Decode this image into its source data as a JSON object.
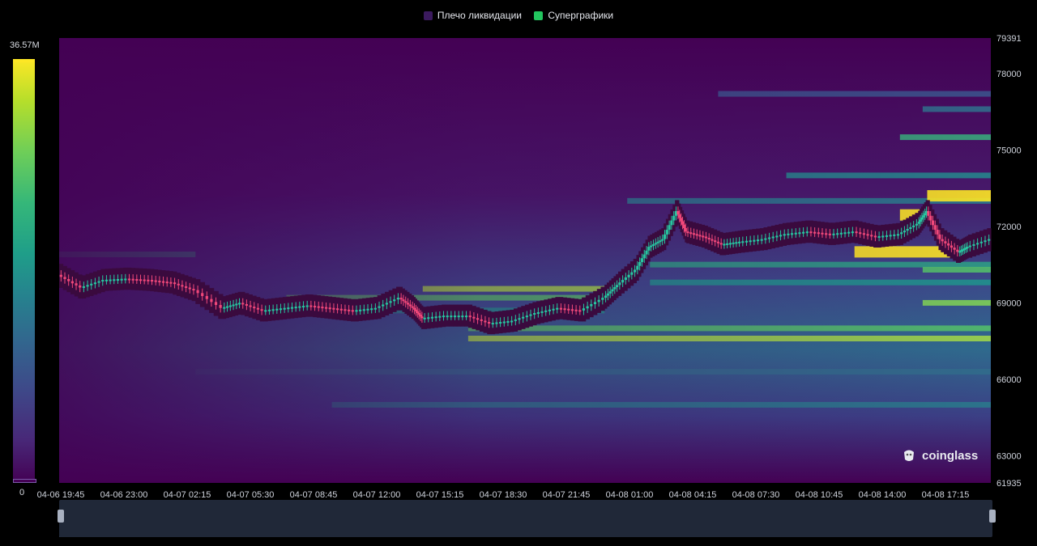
{
  "legend": {
    "items": [
      {
        "label": "Плечо ликвидации",
        "color": "#3b1a5e"
      },
      {
        "label": "Суперграфики",
        "color": "#22c55e"
      }
    ]
  },
  "colorbar": {
    "max_label": "36.57M",
    "min_label": "0"
  },
  "watermark": {
    "text": "coinglass",
    "icon": "coinglass-logo-icon"
  },
  "colors": {
    "background": "#000000",
    "heat_low": "#440154",
    "heat_high": "#fde725",
    "candle_up": "#26c6a0",
    "candle_down": "#f0487a",
    "price_band": "#3a0a3e"
  },
  "chart_data": {
    "type": "heatmap",
    "title": "",
    "x_ticks": [
      "04-06 19:45",
      "04-06 23:00",
      "04-07 02:15",
      "04-07 05:30",
      "04-07 08:45",
      "04-07 12:00",
      "04-07 15:15",
      "04-07 18:30",
      "04-07 21:45",
      "04-08 01:00",
      "04-08 04:15",
      "04-08 07:30",
      "04-08 10:45",
      "04-08 14:00",
      "04-08 17:15"
    ],
    "y_ticks": [
      79391,
      78000,
      75000,
      72000,
      69000,
      66000,
      63000,
      61935
    ],
    "ylim": [
      61935,
      79391
    ],
    "colorbar_range": [
      0,
      36570000
    ],
    "price_path": [
      {
        "t": 0.0,
        "p": 70100
      },
      {
        "t": 0.5,
        "p": 69600
      },
      {
        "t": 1.0,
        "p": 69900
      },
      {
        "t": 1.5,
        "p": 69950
      },
      {
        "t": 2.0,
        "p": 69900
      },
      {
        "t": 2.5,
        "p": 69800
      },
      {
        "t": 3.0,
        "p": 69500
      },
      {
        "t": 3.6,
        "p": 68800
      },
      {
        "t": 4.0,
        "p": 69000
      },
      {
        "t": 4.5,
        "p": 68700
      },
      {
        "t": 5.0,
        "p": 68800
      },
      {
        "t": 5.5,
        "p": 68900
      },
      {
        "t": 6.0,
        "p": 68800
      },
      {
        "t": 6.5,
        "p": 68700
      },
      {
        "t": 7.0,
        "p": 68800
      },
      {
        "t": 7.5,
        "p": 69200
      },
      {
        "t": 7.8,
        "p": 68800
      },
      {
        "t": 8.0,
        "p": 68400
      },
      {
        "t": 8.5,
        "p": 68500
      },
      {
        "t": 9.0,
        "p": 68500
      },
      {
        "t": 9.5,
        "p": 68200
      },
      {
        "t": 10.0,
        "p": 68300
      },
      {
        "t": 10.5,
        "p": 68600
      },
      {
        "t": 11.0,
        "p": 68800
      },
      {
        "t": 11.5,
        "p": 68700
      },
      {
        "t": 12.0,
        "p": 69200
      },
      {
        "t": 12.3,
        "p": 69700
      },
      {
        "t": 12.7,
        "p": 70300
      },
      {
        "t": 13.0,
        "p": 71200
      },
      {
        "t": 13.3,
        "p": 71500
      },
      {
        "t": 13.6,
        "p": 72600
      },
      {
        "t": 13.8,
        "p": 71800
      },
      {
        "t": 14.2,
        "p": 71600
      },
      {
        "t": 14.6,
        "p": 71300
      },
      {
        "t": 15.0,
        "p": 71400
      },
      {
        "t": 15.5,
        "p": 71500
      },
      {
        "t": 16.0,
        "p": 71700
      },
      {
        "t": 16.5,
        "p": 71800
      },
      {
        "t": 17.0,
        "p": 71700
      },
      {
        "t": 17.5,
        "p": 71800
      },
      {
        "t": 18.0,
        "p": 71600
      },
      {
        "t": 18.5,
        "p": 71700
      },
      {
        "t": 18.9,
        "p": 72100
      },
      {
        "t": 19.1,
        "p": 72600
      },
      {
        "t": 19.4,
        "p": 71500
      },
      {
        "t": 19.8,
        "p": 71000
      },
      {
        "t": 20.0,
        "p": 71200
      },
      {
        "t": 20.5,
        "p": 71500
      }
    ],
    "liquidation_bands": [
      {
        "p": 70900,
        "t0": 0,
        "t1": 3.0,
        "level": 0.55
      },
      {
        "p": 69200,
        "t0": 5.0,
        "t1": 12.0,
        "level": 0.7
      },
      {
        "p": 69550,
        "t0": 8.0,
        "t1": 12.0,
        "level": 0.85
      },
      {
        "p": 68700,
        "t0": 5.0,
        "t1": 12.0,
        "level": 0.5
      },
      {
        "p": 68000,
        "t0": 9.0,
        "t1": 20.5,
        "level": 0.7
      },
      {
        "p": 67600,
        "t0": 9.0,
        "t1": 20.5,
        "level": 0.85
      },
      {
        "p": 66300,
        "t0": 3.0,
        "t1": 20.5,
        "level": 0.35
      },
      {
        "p": 65000,
        "t0": 6.0,
        "t1": 20.5,
        "level": 0.4
      },
      {
        "p": 73000,
        "t0": 12.5,
        "t1": 20.5,
        "level": 0.4
      },
      {
        "p": 74000,
        "t0": 16.0,
        "t1": 20.5,
        "level": 0.45
      },
      {
        "p": 75500,
        "t0": 18.5,
        "t1": 20.5,
        "level": 0.6
      },
      {
        "p": 73200,
        "t0": 19.1,
        "t1": 20.5,
        "level": 1.0
      },
      {
        "p": 72450,
        "t0": 18.5,
        "t1": 19.1,
        "level": 1.0
      },
      {
        "p": 71000,
        "t0": 17.5,
        "t1": 19.8,
        "level": 1.0
      },
      {
        "p": 70500,
        "t0": 13.0,
        "t1": 20.5,
        "level": 0.55
      },
      {
        "p": 69800,
        "t0": 13.0,
        "t1": 20.5,
        "level": 0.5
      },
      {
        "p": 69000,
        "t0": 19.0,
        "t1": 20.5,
        "level": 0.8
      },
      {
        "p": 70300,
        "t0": 19.0,
        "t1": 20.5,
        "level": 0.7
      },
      {
        "p": 76600,
        "t0": 19.0,
        "t1": 20.5,
        "level": 0.35
      },
      {
        "p": 77200,
        "t0": 14.5,
        "t1": 20.5,
        "level": 0.25
      }
    ]
  }
}
